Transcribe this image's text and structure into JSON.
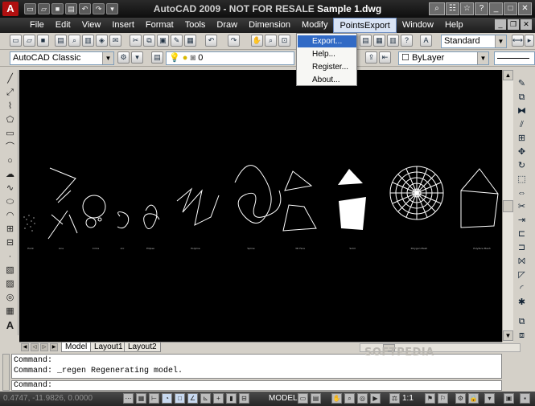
{
  "window": {
    "app_logo": "A",
    "title_app": "AutoCAD 2009 - NOT FOR RESALE",
    "title_doc": "Sample 1.dwg"
  },
  "menu": {
    "items": [
      "File",
      "Edit",
      "View",
      "Insert",
      "Format",
      "Tools",
      "Draw",
      "Dimension",
      "Modify",
      "PointsExport",
      "Window",
      "Help"
    ],
    "active": "PointsExport"
  },
  "points_export_menu": {
    "items": [
      "Export...",
      "Help...",
      "Register...",
      "About..."
    ],
    "highlighted": "Export..."
  },
  "toolbar": {
    "text_style": "Standard",
    "workspace": "AutoCAD Classic",
    "layer_value": "0",
    "color_value": "ByLayer"
  },
  "drawing": {
    "background": "#000000",
    "stroke": "#ffffff",
    "shape_labels": [
      "Point",
      "Line",
      "Circle",
      "Arc",
      "Ellipse",
      "Polyline",
      "Spline",
      "3D Face",
      "Solid",
      "Polygon Mesh",
      "Polyface Mesh"
    ]
  },
  "layout_tabs": [
    "Model",
    "Layout1",
    "Layout2"
  ],
  "active_tab": "Model",
  "command_window": {
    "history": [
      "Command:",
      "Command: _regen Regenerating model."
    ],
    "prompt": "Command:"
  },
  "watermark": "SOFTPEDIA",
  "status": {
    "coordinates": "0.4747, -11.9826, 0.0000",
    "space": "MODEL",
    "annotation_scale": "1:1"
  },
  "colors": {
    "title_bar": "#1a1a1a",
    "menu_highlight": "#316ac5",
    "ui_face": "#d4d0c8"
  }
}
